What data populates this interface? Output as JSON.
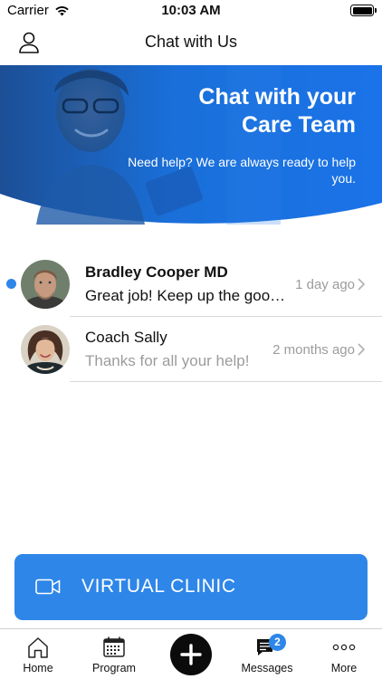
{
  "status_bar": {
    "carrier": "Carrier",
    "time": "10:03 AM",
    "battery_level": 1.0
  },
  "nav": {
    "title": "Chat with Us",
    "profile_icon": "person-icon"
  },
  "hero": {
    "title": "Chat with your\nCare Team",
    "subtitle": "Need help? We are always ready to help you.",
    "accent_color": "#1A73E8"
  },
  "conversations": [
    {
      "name": "Bradley Cooper MD",
      "preview": "Great job! Keep up the good work!",
      "time": "1 day ago",
      "unread": true
    },
    {
      "name": "Coach Sally",
      "preview": "Thanks for all your help!",
      "time": "2 months ago",
      "unread": false
    }
  ],
  "virtual_clinic": {
    "label": "VIRTUAL CLINIC",
    "icon": "video-camera-icon",
    "color": "#2E86E8"
  },
  "tab_bar": {
    "items": [
      {
        "label": "Home",
        "icon": "home-icon"
      },
      {
        "label": "Program",
        "icon": "calendar-icon"
      },
      {
        "label": "",
        "icon": "plus-icon"
      },
      {
        "label": "Messages",
        "icon": "message-icon",
        "badge": "2"
      },
      {
        "label": "More",
        "icon": "more-dots-icon"
      }
    ]
  }
}
